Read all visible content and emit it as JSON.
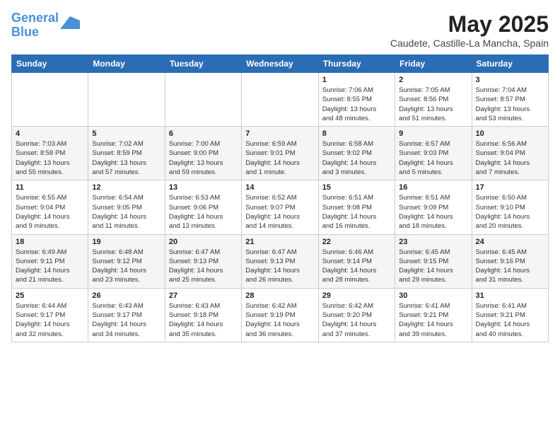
{
  "logo": {
    "line1": "General",
    "line2": "Blue"
  },
  "title": "May 2025",
  "location": "Caudete, Castille-La Mancha, Spain",
  "days_of_week": [
    "Sunday",
    "Monday",
    "Tuesday",
    "Wednesday",
    "Thursday",
    "Friday",
    "Saturday"
  ],
  "weeks": [
    [
      {
        "day": "",
        "info": ""
      },
      {
        "day": "",
        "info": ""
      },
      {
        "day": "",
        "info": ""
      },
      {
        "day": "",
        "info": ""
      },
      {
        "day": "1",
        "info": "Sunrise: 7:06 AM\nSunset: 8:55 PM\nDaylight: 13 hours\nand 48 minutes."
      },
      {
        "day": "2",
        "info": "Sunrise: 7:05 AM\nSunset: 8:56 PM\nDaylight: 13 hours\nand 51 minutes."
      },
      {
        "day": "3",
        "info": "Sunrise: 7:04 AM\nSunset: 8:57 PM\nDaylight: 13 hours\nand 53 minutes."
      }
    ],
    [
      {
        "day": "4",
        "info": "Sunrise: 7:03 AM\nSunset: 8:58 PM\nDaylight: 13 hours\nand 55 minutes."
      },
      {
        "day": "5",
        "info": "Sunrise: 7:02 AM\nSunset: 8:59 PM\nDaylight: 13 hours\nand 57 minutes."
      },
      {
        "day": "6",
        "info": "Sunrise: 7:00 AM\nSunset: 9:00 PM\nDaylight: 13 hours\nand 59 minutes."
      },
      {
        "day": "7",
        "info": "Sunrise: 6:59 AM\nSunset: 9:01 PM\nDaylight: 14 hours\nand 1 minute."
      },
      {
        "day": "8",
        "info": "Sunrise: 6:58 AM\nSunset: 9:02 PM\nDaylight: 14 hours\nand 3 minutes."
      },
      {
        "day": "9",
        "info": "Sunrise: 6:57 AM\nSunset: 9:03 PM\nDaylight: 14 hours\nand 5 minutes."
      },
      {
        "day": "10",
        "info": "Sunrise: 6:56 AM\nSunset: 9:04 PM\nDaylight: 14 hours\nand 7 minutes."
      }
    ],
    [
      {
        "day": "11",
        "info": "Sunrise: 6:55 AM\nSunset: 9:04 PM\nDaylight: 14 hours\nand 9 minutes."
      },
      {
        "day": "12",
        "info": "Sunrise: 6:54 AM\nSunset: 9:05 PM\nDaylight: 14 hours\nand 11 minutes."
      },
      {
        "day": "13",
        "info": "Sunrise: 6:53 AM\nSunset: 9:06 PM\nDaylight: 14 hours\nand 13 minutes."
      },
      {
        "day": "14",
        "info": "Sunrise: 6:52 AM\nSunset: 9:07 PM\nDaylight: 14 hours\nand 14 minutes."
      },
      {
        "day": "15",
        "info": "Sunrise: 6:51 AM\nSunset: 9:08 PM\nDaylight: 14 hours\nand 16 minutes."
      },
      {
        "day": "16",
        "info": "Sunrise: 6:51 AM\nSunset: 9:09 PM\nDaylight: 14 hours\nand 18 minutes."
      },
      {
        "day": "17",
        "info": "Sunrise: 6:50 AM\nSunset: 9:10 PM\nDaylight: 14 hours\nand 20 minutes."
      }
    ],
    [
      {
        "day": "18",
        "info": "Sunrise: 6:49 AM\nSunset: 9:11 PM\nDaylight: 14 hours\nand 21 minutes."
      },
      {
        "day": "19",
        "info": "Sunrise: 6:48 AM\nSunset: 9:12 PM\nDaylight: 14 hours\nand 23 minutes."
      },
      {
        "day": "20",
        "info": "Sunrise: 6:47 AM\nSunset: 9:13 PM\nDaylight: 14 hours\nand 25 minutes."
      },
      {
        "day": "21",
        "info": "Sunrise: 6:47 AM\nSunset: 9:13 PM\nDaylight: 14 hours\nand 26 minutes."
      },
      {
        "day": "22",
        "info": "Sunrise: 6:46 AM\nSunset: 9:14 PM\nDaylight: 14 hours\nand 28 minutes."
      },
      {
        "day": "23",
        "info": "Sunrise: 6:45 AM\nSunset: 9:15 PM\nDaylight: 14 hours\nand 29 minutes."
      },
      {
        "day": "24",
        "info": "Sunrise: 6:45 AM\nSunset: 9:16 PM\nDaylight: 14 hours\nand 31 minutes."
      }
    ],
    [
      {
        "day": "25",
        "info": "Sunrise: 6:44 AM\nSunset: 9:17 PM\nDaylight: 14 hours\nand 32 minutes."
      },
      {
        "day": "26",
        "info": "Sunrise: 6:43 AM\nSunset: 9:17 PM\nDaylight: 14 hours\nand 34 minutes."
      },
      {
        "day": "27",
        "info": "Sunrise: 6:43 AM\nSunset: 9:18 PM\nDaylight: 14 hours\nand 35 minutes."
      },
      {
        "day": "28",
        "info": "Sunrise: 6:42 AM\nSunset: 9:19 PM\nDaylight: 14 hours\nand 36 minutes."
      },
      {
        "day": "29",
        "info": "Sunrise: 6:42 AM\nSunset: 9:20 PM\nDaylight: 14 hours\nand 37 minutes."
      },
      {
        "day": "30",
        "info": "Sunrise: 6:41 AM\nSunset: 9:21 PM\nDaylight: 14 hours\nand 39 minutes."
      },
      {
        "day": "31",
        "info": "Sunrise: 6:41 AM\nSunset: 9:21 PM\nDaylight: 14 hours\nand 40 minutes."
      }
    ]
  ]
}
